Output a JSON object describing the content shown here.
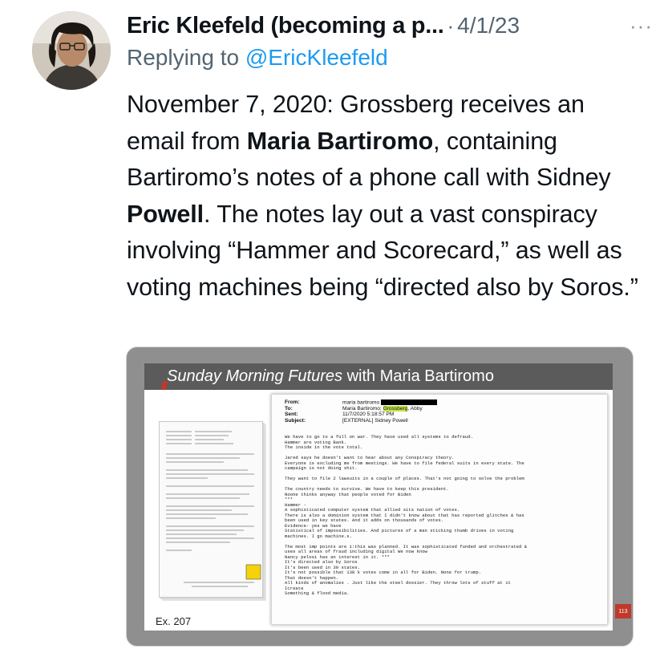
{
  "tweet": {
    "author_name": "Eric Kleefeld (becoming a p...",
    "separator": "·",
    "date": "4/1/23",
    "more": "···",
    "replying_prefix": "Replying to",
    "replying_handle": "@EricKleefeld",
    "body_parts": [
      "November 7, 2020: Grossberg receives an email from ",
      "Maria Bartiromo",
      ", containing Bartiromo’s notes of a phone call with Sidney ",
      "Powell",
      ". The notes lay out a vast conspiracy involving “Hammer and Scorecard,” as well as voting machines being “directed also by Soros.”"
    ]
  },
  "media": {
    "banner_italic": "Sunday Morning Futures",
    "banner_rest": " with Maria Bartiromo",
    "exhibit": "Ex. 207",
    "slide_number": "113",
    "email": {
      "from_label": "From:",
      "from_value": "maria bartiromo",
      "to_label": "To:",
      "to_value_a": "Maria Bartiromo; ",
      "to_value_hl": "Grossberg",
      "to_value_b": ", Abby",
      "sent_label": "Sent:",
      "sent_value": "11/7/2020 5:18:57 PM",
      "subject_label": "Subject:",
      "subject_value": "[EXTERNAL] Sidney Powell",
      "text": "We have to go to a full on war. They have used all systems to defraud.\nHammer are voting Bank.\nThe inside in the vote total.\n\nJared says he doesn't want to hear about any Conspiracy theory.\nEveryone is excluding me from meetings. We have to file federal suits in every state. The\ncampaign is not doing shit.\n\nThey want to file 2 lawsuits in a couple of places. That's not going to solve the problem\n\nThe country needs to survive. We have to keep this president.\nNoone thinks anyway that people voted for Biden\n***\nHammer -\nA sophisticated computer system that allied sits nation of votes.\nThere is also a dominion system that I didn't know about that has reported glitches & has\nbeen used in key states. And it adds on thousands of votes.\nEvidence- yes we have\nStatistical of impossibilities. And pictures of a man sticking thumb drives in voting\nmachines. I go machine.s.\n\nThe most imp points are 1:this was planned. It was sophisticated funded and orchestrated &\nuses all areas of fraud including digital We now know\nNancy pelosi has an interest in it. ***\nIt's directed also by Soros\nIt's been used in 30 states.\nIt's not possible that 138 k votes come in all for Biden. None for trump.\nThat doesn't happen.\nAll kinds of anomalies . Just like the steel dossier. They throw lots of stuff at it\nIcreate\nSomething & flood media."
    }
  }
}
